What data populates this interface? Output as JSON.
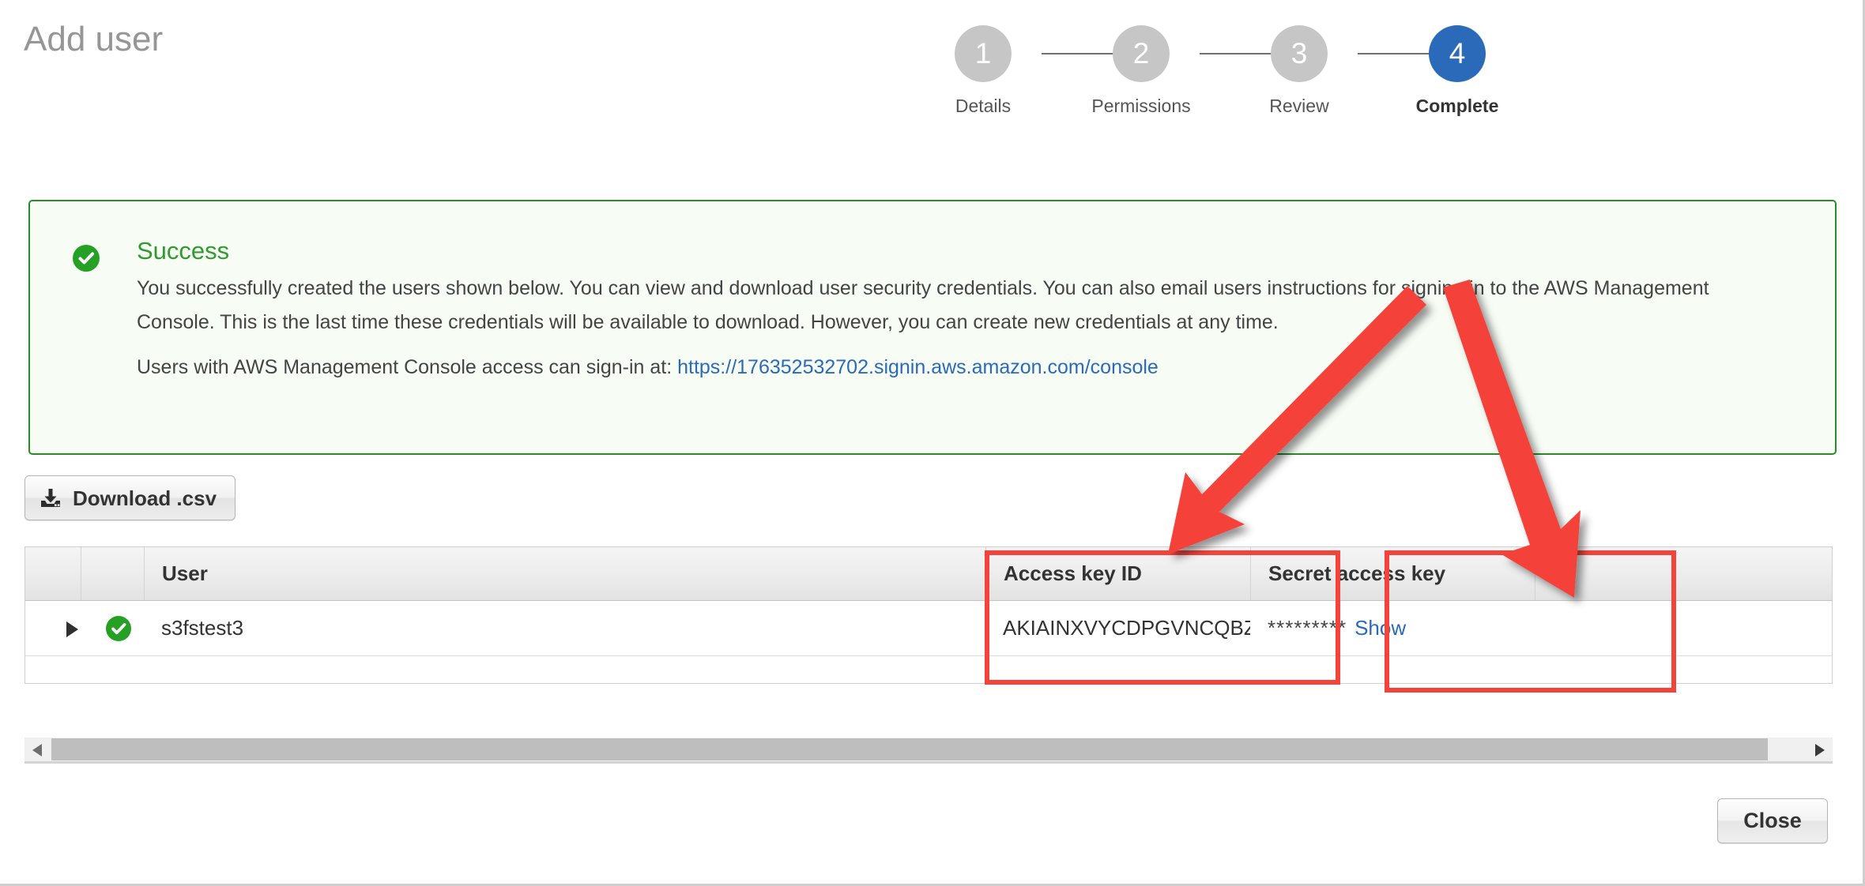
{
  "page": {
    "title": "Add user"
  },
  "stepper": {
    "steps": [
      {
        "number": "1",
        "label": "Details",
        "active": false
      },
      {
        "number": "2",
        "label": "Permissions",
        "active": false
      },
      {
        "number": "3",
        "label": "Review",
        "active": false
      },
      {
        "number": "4",
        "label": "Complete",
        "active": true
      }
    ],
    "active_color": "#2a6ab8",
    "inactive_color": "#c6c6c6"
  },
  "success": {
    "icon": "check-circle-icon",
    "heading": "Success",
    "heading_color": "#2f9b2f",
    "border_color": "#298c29",
    "background_color": "#f7fcf5",
    "body_line_1": "You successfully created the users shown below. You can view and download user security credentials. You can also email users instructions for signing in to the AWS Management Console. This is the last time these credentials will be available to download. However, you can create new credentials at any time.",
    "signin_prefix": "Users with AWS Management Console access can sign-in at: ",
    "signin_url": "https://176352532702.signin.aws.amazon.com/console",
    "link_color": "#2a6ab8"
  },
  "toolbar": {
    "download_icon": "download-icon",
    "download_label": "Download .csv"
  },
  "table": {
    "columns": [
      {
        "key": "expander",
        "label": ""
      },
      {
        "key": "status",
        "label": ""
      },
      {
        "key": "user",
        "label": "User"
      },
      {
        "key": "access_key_id",
        "label": "Access key ID"
      },
      {
        "key": "secret_access_key",
        "label": "Secret access key"
      }
    ],
    "rows": [
      {
        "expander_icon": "triangle-right-icon",
        "status_icon": "check-circle-icon",
        "user": "s3fstest3",
        "access_key_id": "AKIAINXVYCDPGVNCQBZA",
        "secret_mask": "*********",
        "secret_show_label": "Show"
      }
    ]
  },
  "scrollbar": {
    "left_arrow_icon": "triangle-left-icon",
    "right_arrow_icon": "triangle-right-icon",
    "orientation": "horizontal"
  },
  "footer": {
    "close_label": "Close"
  },
  "annotations": {
    "highlight_color": "#f4433a",
    "boxes": [
      {
        "name": "access-key-id-highlight",
        "target": "Access key ID"
      },
      {
        "name": "secret-access-key-highlight",
        "target": "Secret access key"
      }
    ],
    "arrows": [
      {
        "name": "arrow-to-access-key-id",
        "direction": "down-left"
      },
      {
        "name": "arrow-to-secret-access-key",
        "direction": "down-right"
      }
    ]
  }
}
